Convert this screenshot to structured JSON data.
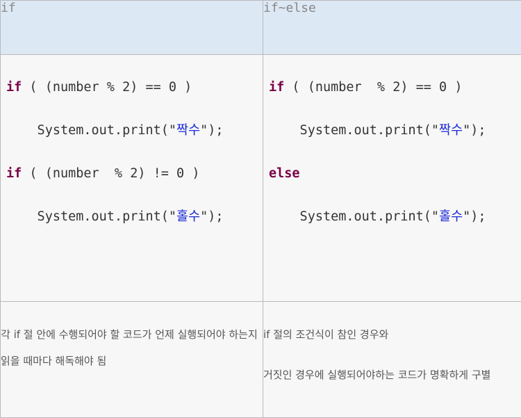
{
  "headers": [
    "if",
    "if~else"
  ],
  "left_code": {
    "if1_kw": "if",
    "if1_rest": " ( (number % 2) == 0 )",
    "print1_pre": "    System.out.print(\"",
    "print1_str": "짝수",
    "print1_post": "\");",
    "if2_kw": "if",
    "if2_rest": " ( (number  % 2) != 0 )",
    "print2_pre": "    System.out.print(\"",
    "print2_str": "홀수",
    "print2_post": "\");"
  },
  "right_code": {
    "if_kw": "if",
    "if_rest": " ( (number  % 2) == 0 )",
    "print1_pre": "    System.out.print(\"",
    "print1_str": "짝수",
    "print1_post": "\");",
    "else_kw": "else",
    "print2_pre": "    System.out.print(\"",
    "print2_str": "홀수",
    "print2_post": "\");"
  },
  "left_desc": "각 if 절 안에 수행되어야 할 코드가 언제 실행되어야 하는지 읽을 때마다 해독해야 됨",
  "right_desc": {
    "line1": "if 절의 조건식이 참인 경우와",
    "line2": "거짓인 경우에 실행되어야하는 코드가 명확하게 구별"
  }
}
